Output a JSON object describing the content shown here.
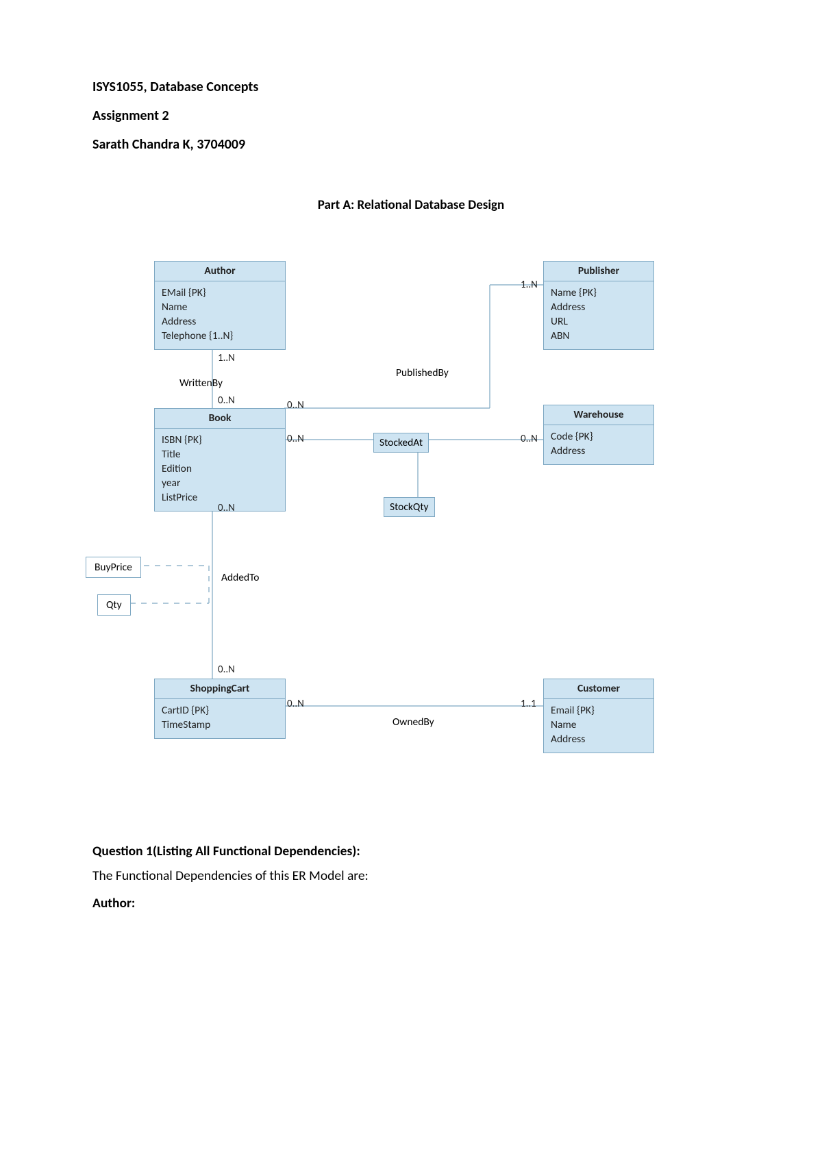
{
  "header": {
    "course": "ISYS1055, Database Concepts",
    "assignment": "Assignment 2",
    "student": "Sarath Chandra K, 3704009"
  },
  "part_title": "Part A: Relational Database Design",
  "diagram": {
    "entities": {
      "author": {
        "title": "Author",
        "attrs": [
          "EMail {PK}",
          "Name",
          "Address",
          "Telephone {1..N}"
        ]
      },
      "publisher": {
        "title": "Publisher",
        "attrs": [
          "Name {PK}",
          "Address",
          "URL",
          "ABN"
        ]
      },
      "book": {
        "title": "Book",
        "attrs": [
          "ISBN {PK}",
          "Title",
          "Edition",
          "year",
          "ListPrice"
        ]
      },
      "warehouse": {
        "title": "Warehouse",
        "attrs": [
          "Code {PK}",
          "Address"
        ]
      },
      "shoppingcart": {
        "title": "ShoppingCart",
        "attrs": [
          "CartID {PK}",
          "TimeStamp"
        ]
      },
      "customer": {
        "title": "Customer",
        "attrs": [
          "Email {PK}",
          "Name",
          "Address"
        ]
      }
    },
    "relationships": {
      "writtenby": "WrittenBy",
      "publishedby": "PublishedBy",
      "stockedat": "StockedAt",
      "stockqty": "StockQty",
      "addedto": "AddedTo",
      "ownedby": "OwnedBy"
    },
    "attributes": {
      "buyprice": "BuyPrice",
      "qty": "Qty"
    },
    "cardinalities": {
      "author_writtenby": "1..N",
      "book_writtenby": "0..N",
      "book_publishedby": "0..N",
      "publisher_publishedby": "1..N",
      "book_stockedat": "0..N",
      "warehouse_stockedat": "0..N",
      "book_addedto": "0..N",
      "cart_addedto": "0..N",
      "cart_ownedby": "0..N",
      "customer_ownedby": "1..1"
    }
  },
  "question1": {
    "title": "Question 1(Listing All Functional Dependencies):",
    "intro": "The Functional Dependencies of this ER Model are:",
    "section": "Author:"
  }
}
